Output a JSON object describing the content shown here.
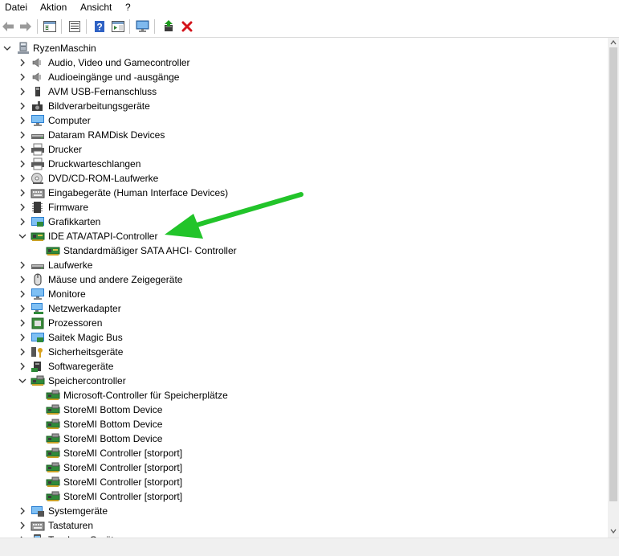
{
  "menu": {
    "items": [
      {
        "label": "Datei"
      },
      {
        "label": "Aktion"
      },
      {
        "label": "Ansicht"
      },
      {
        "label": "?"
      }
    ]
  },
  "toolbar": {
    "buttons": [
      {
        "icon": "back-arrow-icon"
      },
      {
        "icon": "forward-arrow-icon"
      },
      {
        "icon": "console-tree-icon"
      },
      {
        "icon": "properties-icon"
      },
      {
        "icon": "help-icon"
      },
      {
        "icon": "action-pane-icon"
      },
      {
        "icon": "monitor-icon"
      },
      {
        "icon": "update-driver-icon"
      },
      {
        "icon": "uninstall-x-icon"
      }
    ],
    "accent_red": "#d4141b",
    "accent_green": "#1d9b1d"
  },
  "tree": {
    "root": {
      "label": "RyzenMaschin",
      "expanded": true,
      "icon": "computer-root-icon"
    },
    "items": [
      {
        "label": "Audio, Video und Gamecontroller",
        "icon": "speaker-icon",
        "level": 1,
        "expander": "collapsed"
      },
      {
        "label": "Audioeingänge und -ausgänge",
        "icon": "speaker-icon",
        "level": 1,
        "expander": "collapsed"
      },
      {
        "label": "AVM USB-Fernanschluss",
        "icon": "usb-device-icon",
        "level": 1,
        "expander": "collapsed"
      },
      {
        "label": "Bildverarbeitungsgeräte",
        "icon": "camera-icon",
        "level": 1,
        "expander": "collapsed"
      },
      {
        "label": "Computer",
        "icon": "monitor-icon",
        "level": 1,
        "expander": "collapsed"
      },
      {
        "label": "Dataram RAMDisk Devices",
        "icon": "drive-icon",
        "level": 1,
        "expander": "collapsed"
      },
      {
        "label": "Drucker",
        "icon": "printer-icon",
        "level": 1,
        "expander": "collapsed"
      },
      {
        "label": "Druckwarteschlangen",
        "icon": "printer-icon",
        "level": 1,
        "expander": "collapsed"
      },
      {
        "label": "DVD/CD-ROM-Laufwerke",
        "icon": "disc-icon",
        "level": 1,
        "expander": "collapsed"
      },
      {
        "label": "Eingabegeräte (Human Interface Devices)",
        "icon": "keyboard-icon",
        "level": 1,
        "expander": "collapsed"
      },
      {
        "label": "Firmware",
        "icon": "chip-icon",
        "level": 1,
        "expander": "collapsed"
      },
      {
        "label": "Grafikkarten",
        "icon": "display-adapter-icon",
        "level": 1,
        "expander": "collapsed"
      },
      {
        "label": "IDE ATA/ATAPI-Controller",
        "icon": "controller-card-icon",
        "level": 1,
        "expander": "expanded"
      },
      {
        "label": "Standardmäßiger SATA AHCI- Controller",
        "icon": "controller-card-icon",
        "level": 2,
        "expander": "none"
      },
      {
        "label": "Laufwerke",
        "icon": "drive-icon",
        "level": 1,
        "expander": "collapsed"
      },
      {
        "label": "Mäuse und andere Zeigegeräte",
        "icon": "mouse-icon",
        "level": 1,
        "expander": "collapsed"
      },
      {
        "label": "Monitore",
        "icon": "monitor-icon",
        "level": 1,
        "expander": "collapsed"
      },
      {
        "label": "Netzwerkadapter",
        "icon": "network-icon",
        "level": 1,
        "expander": "collapsed"
      },
      {
        "label": "Prozessoren",
        "icon": "processor-icon",
        "level": 1,
        "expander": "collapsed"
      },
      {
        "label": "Saitek Magic Bus",
        "icon": "display-adapter-icon",
        "level": 1,
        "expander": "collapsed"
      },
      {
        "label": "Sicherheitsgeräte",
        "icon": "security-key-icon",
        "level": 1,
        "expander": "collapsed"
      },
      {
        "label": "Softwaregeräte",
        "icon": "software-device-icon",
        "level": 1,
        "expander": "collapsed"
      },
      {
        "label": "Speichercontroller",
        "icon": "storage-controller-icon",
        "level": 1,
        "expander": "expanded"
      },
      {
        "label": "Microsoft-Controller für Speicherplätze",
        "icon": "storage-controller-icon",
        "level": 2,
        "expander": "none"
      },
      {
        "label": "StoreMI Bottom Device",
        "icon": "storage-controller-icon",
        "level": 2,
        "expander": "none"
      },
      {
        "label": "StoreMI Bottom Device",
        "icon": "storage-controller-icon",
        "level": 2,
        "expander": "none"
      },
      {
        "label": "StoreMI Bottom Device",
        "icon": "storage-controller-icon",
        "level": 2,
        "expander": "none"
      },
      {
        "label": "StoreMI Controller [storport]",
        "icon": "storage-controller-icon",
        "level": 2,
        "expander": "none"
      },
      {
        "label": "StoreMI Controller [storport]",
        "icon": "storage-controller-icon",
        "level": 2,
        "expander": "none"
      },
      {
        "label": "StoreMI Controller [storport]",
        "icon": "storage-controller-icon",
        "level": 2,
        "expander": "none"
      },
      {
        "label": "StoreMI Controller [storport]",
        "icon": "storage-controller-icon",
        "level": 2,
        "expander": "none"
      },
      {
        "label": "Systemgeräte",
        "icon": "system-device-icon",
        "level": 1,
        "expander": "collapsed"
      },
      {
        "label": "Tastaturen",
        "icon": "keyboard-icon",
        "level": 1,
        "expander": "collapsed"
      },
      {
        "label": "Tragbare Geräte",
        "icon": "portable-device-icon",
        "level": 1,
        "expander": "collapsed"
      }
    ]
  },
  "annotation": {
    "icon": "green-pointer-arrow-icon",
    "color": "#22c42a"
  }
}
